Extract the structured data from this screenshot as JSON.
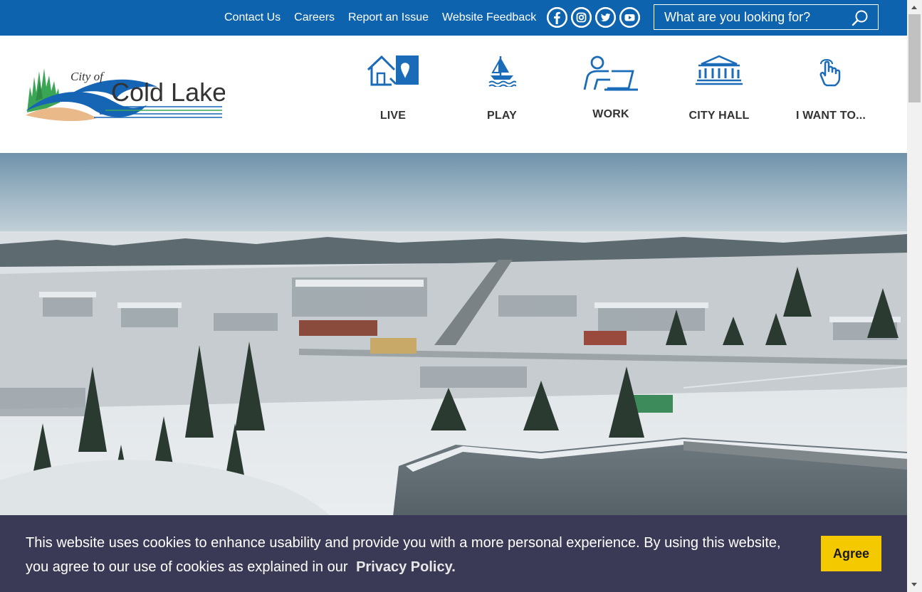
{
  "colors": {
    "topbar": "#0d63ad",
    "nav_icon": "#1a6bb8",
    "cookie_bg": "#3a3a56",
    "agree_bg": "#f5c900"
  },
  "topbar": {
    "links": [
      "Contact Us",
      "Careers",
      "Report an Issue",
      "Website Feedback"
    ],
    "social_icons": [
      "facebook-icon",
      "instagram-icon",
      "twitter-icon",
      "youtube-icon"
    ],
    "search_placeholder": "What are you looking for?",
    "search_icon": "search-icon"
  },
  "logo": {
    "city_of": "City of",
    "name": "Cold Lake"
  },
  "nav": {
    "items": [
      {
        "label": "LIVE",
        "icon": "house-location-icon"
      },
      {
        "label": "PLAY",
        "icon": "sailboat-icon"
      },
      {
        "label": "WORK",
        "icon": "person-laptop-icon"
      },
      {
        "label": "CITY HALL",
        "icon": "city-hall-building-icon"
      },
      {
        "label": "I WANT TO...",
        "icon": "pointing-hand-icon"
      }
    ]
  },
  "hero": {
    "image": "aerial-winter-town-photo"
  },
  "cookie": {
    "message": "This website uses cookies to enhance usability and provide you with a more personal experience. By using this website, you agree to our use of cookies as explained in our",
    "policy_link": "Privacy Policy.",
    "agree_label": "Agree"
  }
}
